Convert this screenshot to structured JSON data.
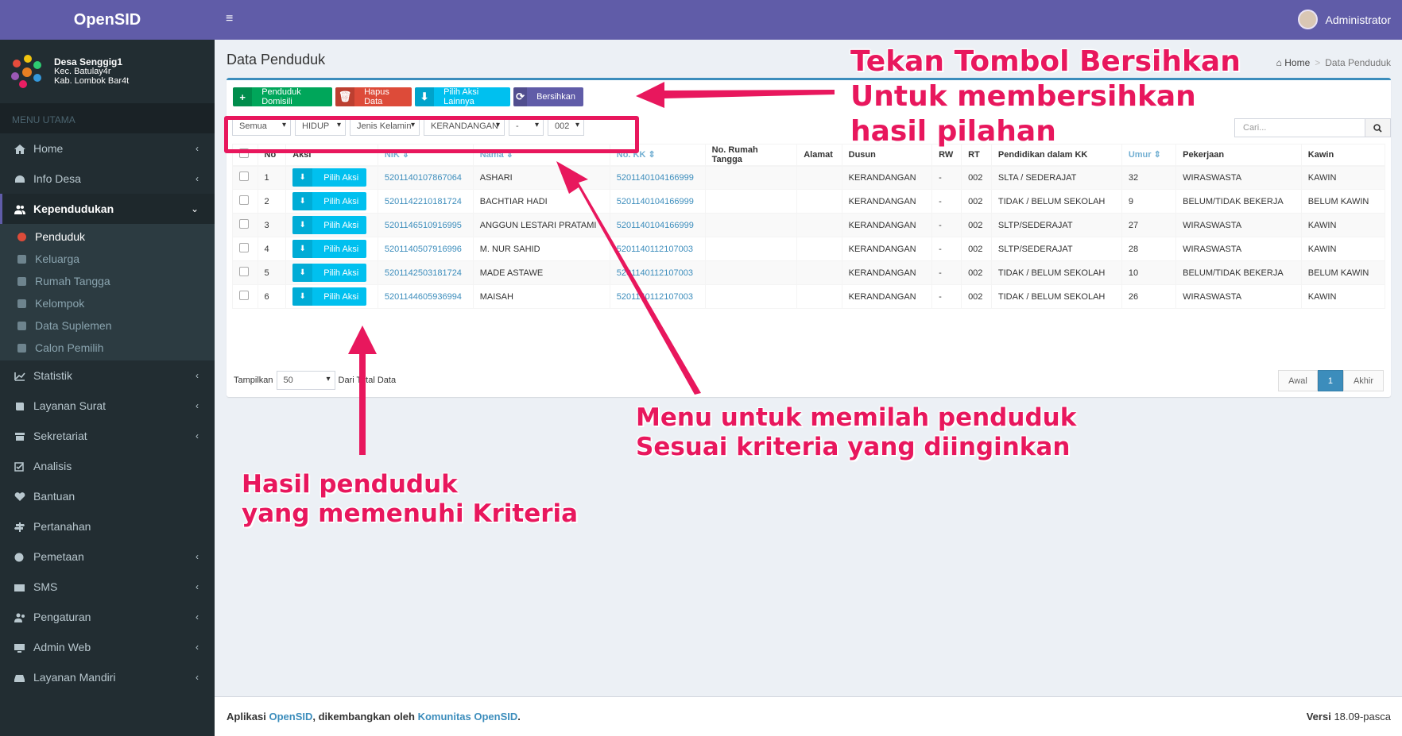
{
  "app": {
    "brand": "OpenSID"
  },
  "desa": {
    "name": "Desa Senggig1",
    "kec": "Kec. Batulay4r",
    "kab": "Kab. Lombok Bar4t"
  },
  "sidebar": {
    "header": "MENU UTAMA",
    "items": [
      {
        "label": "Home",
        "icon": "home-icon",
        "chevron": "‹"
      },
      {
        "label": "Info Desa",
        "icon": "dashboard-icon",
        "chevron": "‹"
      },
      {
        "label": "Kependudukan",
        "icon": "users-icon",
        "chevron": "⌄"
      }
    ],
    "subitems": [
      {
        "label": "Penduduk",
        "icon": "user-icon"
      },
      {
        "label": "Keluarga",
        "icon": "users-icon"
      },
      {
        "label": "Rumah Tangga",
        "icon": "venus-mars-icon"
      },
      {
        "label": "Kelompok",
        "icon": "sitemap-icon"
      },
      {
        "label": "Data Suplemen",
        "icon": "dot-circle-icon"
      },
      {
        "label": "Calon Pemilih",
        "icon": "dot-circle-icon"
      }
    ],
    "items2": [
      {
        "label": "Statistik",
        "icon": "chart-icon",
        "chevron": "‹"
      },
      {
        "label": "Layanan Surat",
        "icon": "book-icon",
        "chevron": "‹"
      },
      {
        "label": "Sekretariat",
        "icon": "archive-icon",
        "chevron": "‹"
      },
      {
        "label": "Analisis",
        "icon": "check-square-icon",
        "chevron": ""
      },
      {
        "label": "Bantuan",
        "icon": "heart-icon",
        "chevron": ""
      },
      {
        "label": "Pertanahan",
        "icon": "map-signs-icon",
        "chevron": ""
      },
      {
        "label": "Pemetaan",
        "icon": "globe-icon",
        "chevron": "‹"
      },
      {
        "label": "SMS",
        "icon": "envelope-icon",
        "chevron": "‹"
      },
      {
        "label": "Pengaturan",
        "icon": "users-cog-icon",
        "chevron": "‹"
      },
      {
        "label": "Admin Web",
        "icon": "desktop-icon",
        "chevron": "‹"
      },
      {
        "label": "Layanan Mandiri",
        "icon": "drive-icon",
        "chevron": "‹"
      }
    ]
  },
  "navbar": {
    "user": "Administrator"
  },
  "page": {
    "title": "Data Penduduk",
    "breadcrumb": [
      "Home",
      "Data Penduduk"
    ]
  },
  "toolbar": {
    "domisili": "Penduduk Domisili",
    "hapus": "Hapus Data",
    "pilih": "Pilih Aksi Lainnya",
    "bersihkan": "Bersihkan"
  },
  "filters": [
    "Semua",
    "HIDUP",
    "Jenis Kelamin",
    "KERANDANGAN",
    "-",
    "002"
  ],
  "search": {
    "placeholder": "Cari..."
  },
  "table": {
    "headers": [
      "No",
      "Aksi",
      "NIK ⇕",
      "Nama ⇕",
      "No. KK ⇕",
      "No. Rumah Tangga",
      "Alamat",
      "Dusun",
      "RW",
      "RT",
      "Pendidikan dalam KK",
      "Umur ⇕",
      "Pekerjaan",
      "Kawin"
    ],
    "action_label": "Pilih Aksi",
    "rows": [
      [
        "1",
        "5201140107867064",
        "ASHARI",
        "5201140104166999",
        "",
        "",
        "KERANDANGAN",
        "-",
        "002",
        "SLTA / SEDERAJAT",
        "32",
        "WIRASWASTA",
        "KAWIN"
      ],
      [
        "2",
        "5201142210181724",
        "BACHTIAR HADI",
        "5201140104166999",
        "",
        "",
        "KERANDANGAN",
        "-",
        "002",
        "TIDAK / BELUM SEKOLAH",
        "9",
        "BELUM/TIDAK BEKERJA",
        "BELUM KAWIN"
      ],
      [
        "3",
        "5201146510916995",
        "ANGGUN LESTARI PRATAMI",
        "5201140104166999",
        "",
        "",
        "KERANDANGAN",
        "-",
        "002",
        "SLTP/SEDERAJAT",
        "27",
        "WIRASWASTA",
        "KAWIN"
      ],
      [
        "4",
        "5201140507916996",
        "M. NUR SAHID",
        "5201140112107003",
        "",
        "",
        "KERANDANGAN",
        "-",
        "002",
        "SLTP/SEDERAJAT",
        "28",
        "WIRASWASTA",
        "KAWIN"
      ],
      [
        "5",
        "5201142503181724",
        "MADE ASTAWE",
        "5201140112107003",
        "",
        "",
        "KERANDANGAN",
        "-",
        "002",
        "TIDAK / BELUM SEKOLAH",
        "10",
        "BELUM/TIDAK BEKERJA",
        "BELUM KAWIN"
      ],
      [
        "6",
        "5201144605936994",
        "MAISAH",
        "5201140112107003",
        "",
        "",
        "KERANDANGAN",
        "-",
        "002",
        "TIDAK / BELUM SEKOLAH",
        "26",
        "WIRASWASTA",
        "KAWIN"
      ]
    ]
  },
  "pagination": {
    "tampilkan": "Tampilkan",
    "per_page": "50",
    "total_text": "Dari Total Data",
    "first": "Awal",
    "current": "1",
    "last": "Akhir"
  },
  "footer": {
    "prefix": "Aplikasi ",
    "app": "OpenSID",
    "mid": ", dikembangkan oleh ",
    "community": "Komunitas OpenSID",
    "end": ".",
    "versi_label": "Versi",
    "versi": "18.09-pasca"
  },
  "annotations": {
    "bersihkan": [
      "Tekan Tombol Bersihkan",
      "Untuk membersihkan",
      "hasil pilahan"
    ],
    "menu": [
      "Menu untuk memilah penduduk",
      "Sesuai kriteria yang diinginkan"
    ],
    "hasil": [
      "Hasil penduduk",
      "yang memenuhi Kriteria"
    ]
  },
  "colors": {
    "brand": "#605ca8",
    "sidebar": "#222d32",
    "annotation": "#e8175d",
    "link": "#3c8dbc"
  }
}
